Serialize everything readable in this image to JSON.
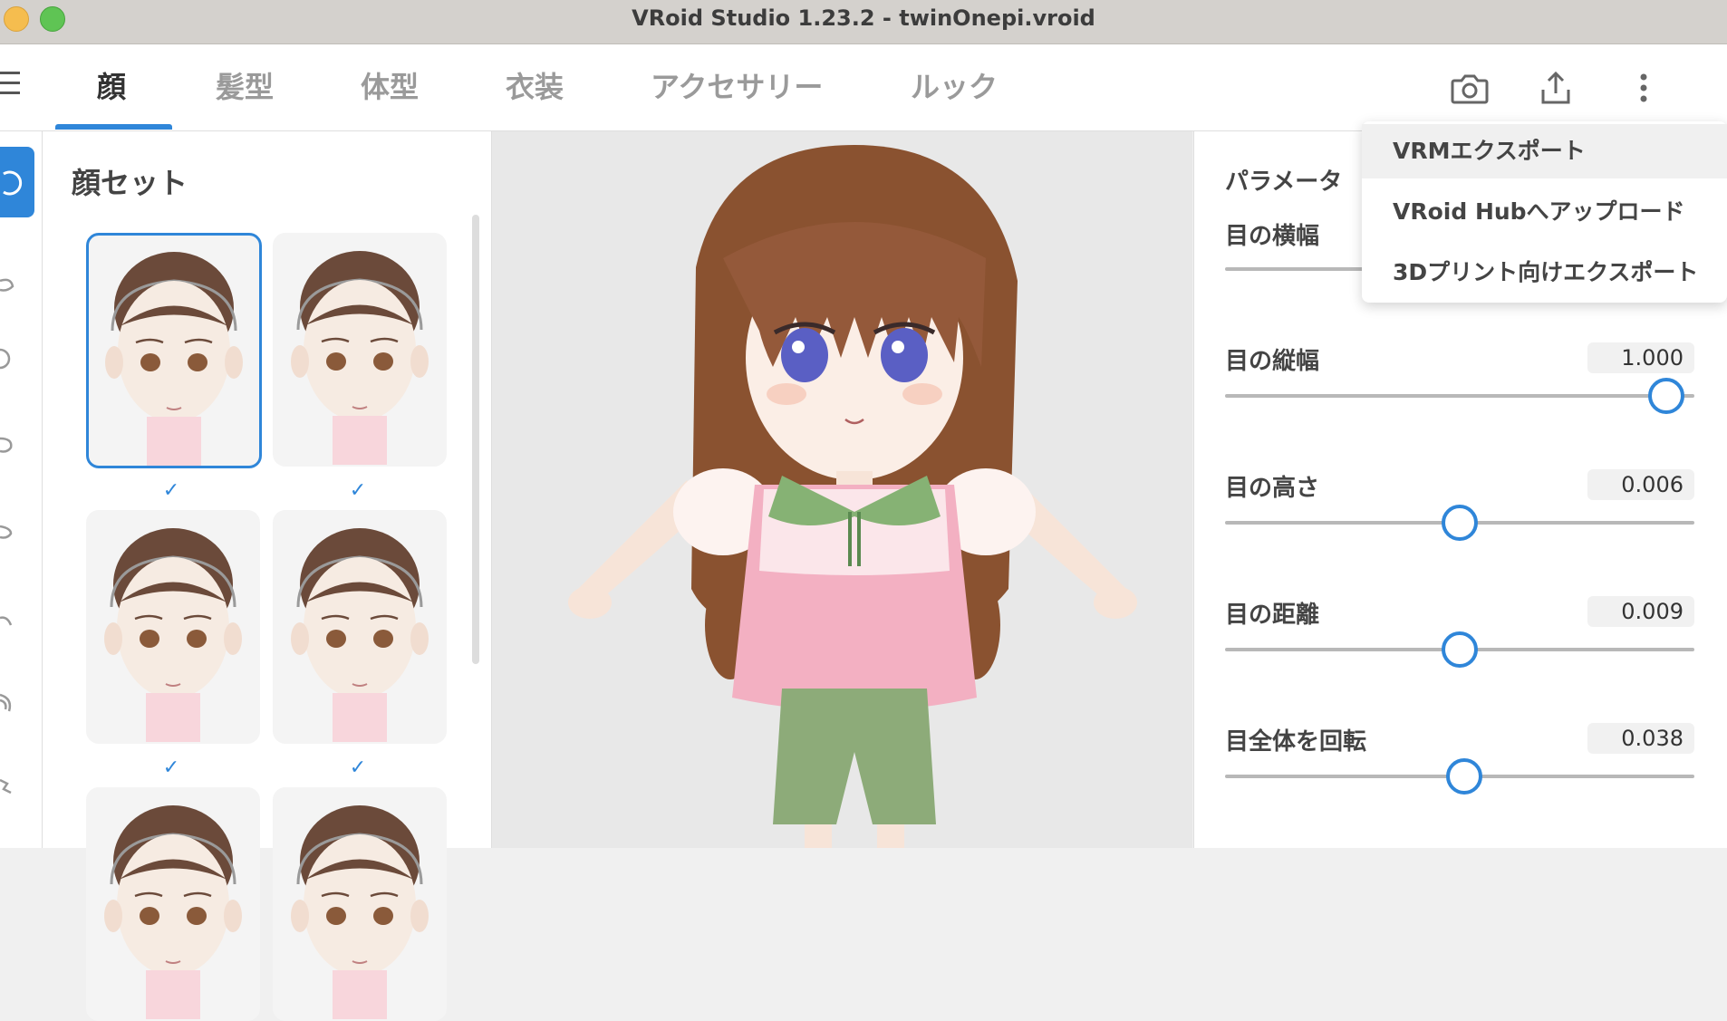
{
  "window": {
    "title": "VRoid Studio 1.23.2 - twinOnepi.vroid"
  },
  "tabs": [
    {
      "label": "顔",
      "active": true
    },
    {
      "label": "髪型"
    },
    {
      "label": "体型"
    },
    {
      "label": "衣装"
    },
    {
      "label": "アクセサリー"
    },
    {
      "label": "ルック"
    }
  ],
  "toolbar_icons": [
    "camera-icon",
    "export-icon",
    "more-vertical-icon"
  ],
  "colors": {
    "accent": "#2f86d9",
    "background": "#f0f0f0"
  },
  "faceset": {
    "title": "顔セット",
    "check": "✓",
    "items": [
      {
        "selected": true,
        "checked": true
      },
      {
        "selected": false,
        "checked": true
      },
      {
        "selected": false,
        "checked": true
      },
      {
        "selected": false,
        "checked": true
      },
      {
        "selected": false,
        "checked": false
      },
      {
        "selected": false,
        "checked": false
      }
    ]
  },
  "params": {
    "header": "パラメータ",
    "items": [
      {
        "label": "目の横幅",
        "value": "",
        "level": null
      },
      {
        "label": "目の縦幅",
        "value": "1.000",
        "level": 0.94
      },
      {
        "label": "目の高さ",
        "value": "0.006",
        "level": 0.5
      },
      {
        "label": "目の距離",
        "value": "0.009",
        "level": 0.5
      },
      {
        "label": "目全体を回転",
        "value": "0.038",
        "level": 0.51
      }
    ]
  },
  "dropdown": {
    "items": [
      {
        "label": "VRMエクスポート"
      },
      {
        "label": "VRoid Hubへアップロード"
      },
      {
        "label": "3Dプリント向けエクスポート"
      }
    ]
  }
}
